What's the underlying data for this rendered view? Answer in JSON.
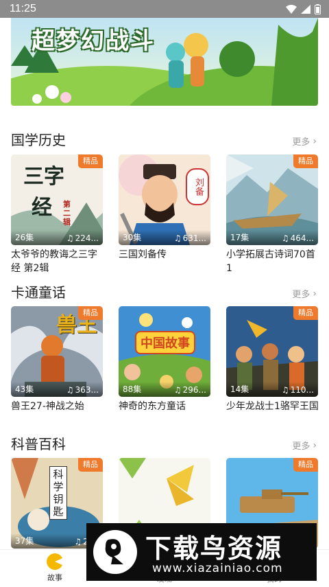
{
  "status_bar": {
    "time": "11:25"
  },
  "banner": {
    "title": "超梦幻战斗"
  },
  "sections": [
    {
      "title": "国学历史",
      "more": "更多",
      "cards": [
        {
          "badge": "精品",
          "episodes": "26集",
          "plays": "224...",
          "title": "太爷爷的教诲之三字经 第2辑"
        },
        {
          "badge": "",
          "episodes": "30集",
          "plays": "631...",
          "title": "三国刘备传"
        },
        {
          "badge": "精品",
          "episodes": "17集",
          "plays": "464...",
          "title": "小学拓展古诗词70首 1"
        }
      ]
    },
    {
      "title": "卡通童话",
      "more": "更多",
      "cards": [
        {
          "badge": "精品",
          "episodes": "43集",
          "plays": "363...",
          "title": "兽王27-神战之始"
        },
        {
          "badge": "",
          "episodes": "88集",
          "plays": "296...",
          "title": "神奇的东方童话"
        },
        {
          "badge": "精品",
          "episodes": "14集",
          "plays": "110...",
          "title": "少年龙战士1骆罕王国"
        }
      ]
    },
    {
      "title": "科普百科",
      "more": "更多",
      "cards": [
        {
          "badge": "精品",
          "episodes": "37集",
          "plays": "284"
        },
        {
          "badge": ""
        },
        {
          "badge": "精品"
        }
      ]
    }
  ],
  "cover_text": {
    "sanzijing_1": "三字",
    "sanzijing_2": "经",
    "sanzijing_vol": "第二辑",
    "liubei": "刘备",
    "zhongguo": "中国故事",
    "shouwang": "兽王",
    "kexue": "科学钥匙"
  },
  "tabbar": {
    "tabs": [
      {
        "label": "故事"
      },
      {
        "label": "发现"
      },
      {
        "label": "我的"
      }
    ]
  },
  "watermark": {
    "text": "下载鸟资源",
    "url": "www.xiazainiao.com"
  }
}
